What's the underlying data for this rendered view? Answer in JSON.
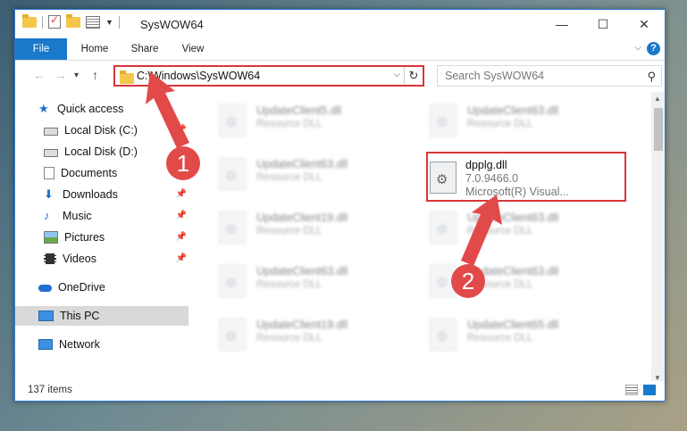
{
  "window": {
    "title": "SysWOW64",
    "minimize": "—",
    "maximize": "☐",
    "close": "✕"
  },
  "ribbon": {
    "tabs": [
      "File",
      "Home",
      "Share",
      "View"
    ],
    "help": "?"
  },
  "nav": {
    "back": "←",
    "forward": "→",
    "recent": "▾",
    "up": "↑",
    "address": "C:\\Windows\\SysWOW64",
    "address_dropdown": "⌵",
    "refresh": "↻",
    "search_placeholder": "Search SysWOW64",
    "search_icon": "⚲"
  },
  "sidebar": {
    "items": [
      {
        "label": "Quick access",
        "icon": "star-icon"
      },
      {
        "label": "Local Disk (C:)",
        "icon": "drive-icon"
      },
      {
        "label": "Local Disk (D:)",
        "icon": "drive-icon"
      },
      {
        "label": "Documents",
        "icon": "documents-icon"
      },
      {
        "label": "Downloads",
        "icon": "download-icon"
      },
      {
        "label": "Music",
        "icon": "music-icon"
      },
      {
        "label": "Pictures",
        "icon": "pictures-icon"
      },
      {
        "label": "Videos",
        "icon": "videos-icon"
      },
      {
        "label": "OneDrive",
        "icon": "cloud-icon"
      },
      {
        "label": "This PC",
        "icon": "computer-icon"
      },
      {
        "label": "Network",
        "icon": "network-icon"
      }
    ],
    "pin": "📌"
  },
  "files": [
    {
      "name": "UpdateClient5.dll",
      "type": "Resource DLL"
    },
    {
      "name": "UpdateClient63.dll",
      "type": "Resource DLL"
    },
    {
      "name": "UpdateClient63.dll",
      "type": "Resource DLL"
    },
    {
      "name": "UpdateClient19.dll",
      "type": "Resource DLL"
    },
    {
      "name": "UpdateClient63.dll",
      "type": "Resource DLL"
    },
    {
      "name": "UpdateClient63.dll",
      "type": "Resource DLL"
    },
    {
      "name": "UpdateClient63.dll",
      "type": "Resource DLL"
    },
    {
      "name": "UpdateClient19.dll",
      "type": "Resource DLL"
    },
    {
      "name": "UpdateClient65.dll",
      "type": "Resource DLL"
    }
  ],
  "highlighted_file": {
    "name": "dpplg.dll",
    "version": "7.0.9466.0",
    "company": "Microsoft(R) Visual..."
  },
  "status": {
    "count": "137 items"
  },
  "annotations": {
    "step1": "1",
    "step2": "2",
    "color": "#e24a4a"
  }
}
